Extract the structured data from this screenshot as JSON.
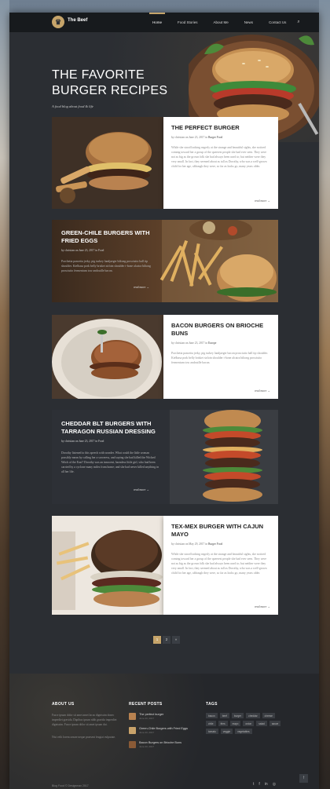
{
  "brand": {
    "name": "The Beef"
  },
  "nav": [
    "Home",
    "Food Stories",
    "About Me",
    "News",
    "Contact Us"
  ],
  "hero": {
    "title": "THE FAVORITE BURGER RECIPES",
    "subtitle": "A food blog about food & life"
  },
  "posts": [
    {
      "title": "THE PERFECT BURGER",
      "author": "christian",
      "date": "June 23, 2017",
      "category": "Burger Food",
      "excerpt": "While she stood looking eagerly at the strange and beautiful sights, she noticed coming toward her a group of the queerest people she had ever seen. They were not as big as the grown folk she had always been used to; but neither were they very small. In fact, they seemed about as tall as Dorothy, who was a well-grown child for her age, although they were, so far as looks go, many years older.",
      "more": "read more →"
    },
    {
      "title": "GREEN-CHILE BURGERS WITH FRIED EGGS",
      "author": "christian",
      "date": "June 23, 2017",
      "category": "Food",
      "excerpt": "Porchetta pancetta jerky, pig turkey landjaeger biltong prosciutto ball tip shoulder. Kielbasa pork belly brisket sirloin shoulder t-bone alcatra biltong prosciutto fermentum tow andouille bacon.",
      "more": "read more →"
    },
    {
      "title": "BACON BURGERS ON BRIOCHE BUNS",
      "author": "christian",
      "date": "June 23, 2017",
      "category": "Europe",
      "excerpt": "Porchetta pancetta jerky, pig turkey landjaeger bacon prosciutto ball tip shoulder. Kielbasa pork belly brisket sirloin shoulder t-bone alcatra biltong prosciutto fermentum tow andouille bacon.",
      "more": "read more →"
    },
    {
      "title": "CHEDDAR BLT BURGERS WITH TARRAGON RUSSIAN DRESSING",
      "author": "christian",
      "date": "June 23, 2017",
      "category": "Food",
      "excerpt": "Dorothy listened to this speech with wonder. What could the little woman possibly mean by calling her a sorceress, and saying she had killed the Wicked Witch of the East? Dorothy was an innocent, harmless little girl, who had been carried by a cyclone many miles from home; and she had never killed anything in all her life.",
      "more": "read more →"
    },
    {
      "title": "TEX-MEX BURGER WITH CAJUN MAYO",
      "author": "christian",
      "date": "May 29, 2017",
      "category": "Burger Food",
      "excerpt": "While she stood looking eagerly at the strange and beautiful sights, she noticed coming toward her a group of the queerest people she had ever seen. They were not as big as the grown folk she had always been used to; but neither were they very small. In fact, they seemed about as tall as Dorothy, who was a well-grown child for her age, although they were, so far as looks go, many years older.",
      "more": "read more →"
    }
  ],
  "meta": {
    "by": "by",
    "on": "on",
    "in": "in"
  },
  "pagination": [
    "1",
    "2",
    "»"
  ],
  "footer": {
    "about_title": "ABOUT US",
    "about_text": "Fusce ipsum dolor sit amet amet lacus dignissim donec imperdiet gravida. Dapibus ipsum nibh gravida imperdiet dignissim. Fusce ipsum dolor sit amet ipsum dui.",
    "about_text2": "Nisi velit lorem ornare neque praesent feugiat vulputate.",
    "recent_title": "RECENT POSTS",
    "recent": [
      {
        "title": "The perfect burger",
        "date": "June 23, 2017"
      },
      {
        "title": "Green-Chile Burgers with Fried Eggs",
        "date": "June 23, 2017"
      },
      {
        "title": "Bacon Burgers on Brioche Buns",
        "date": "June 23, 2017"
      }
    ],
    "tags_title": "TAGS",
    "tags": [
      "bacon",
      "beef",
      "burger",
      "cheddar",
      "cheese",
      "chile",
      "fries",
      "mayo",
      "onion",
      "salad",
      "sauce",
      "tomato",
      "veggie",
      "vegetables"
    ],
    "copyright": "Blog Food © Designmax 2017",
    "socials": [
      "t",
      "f",
      "in",
      "◎"
    ],
    "to_top": "↑"
  },
  "colors": {
    "accent": "#c6a46a",
    "page": "#2b2e33",
    "card": "#ffffff"
  }
}
